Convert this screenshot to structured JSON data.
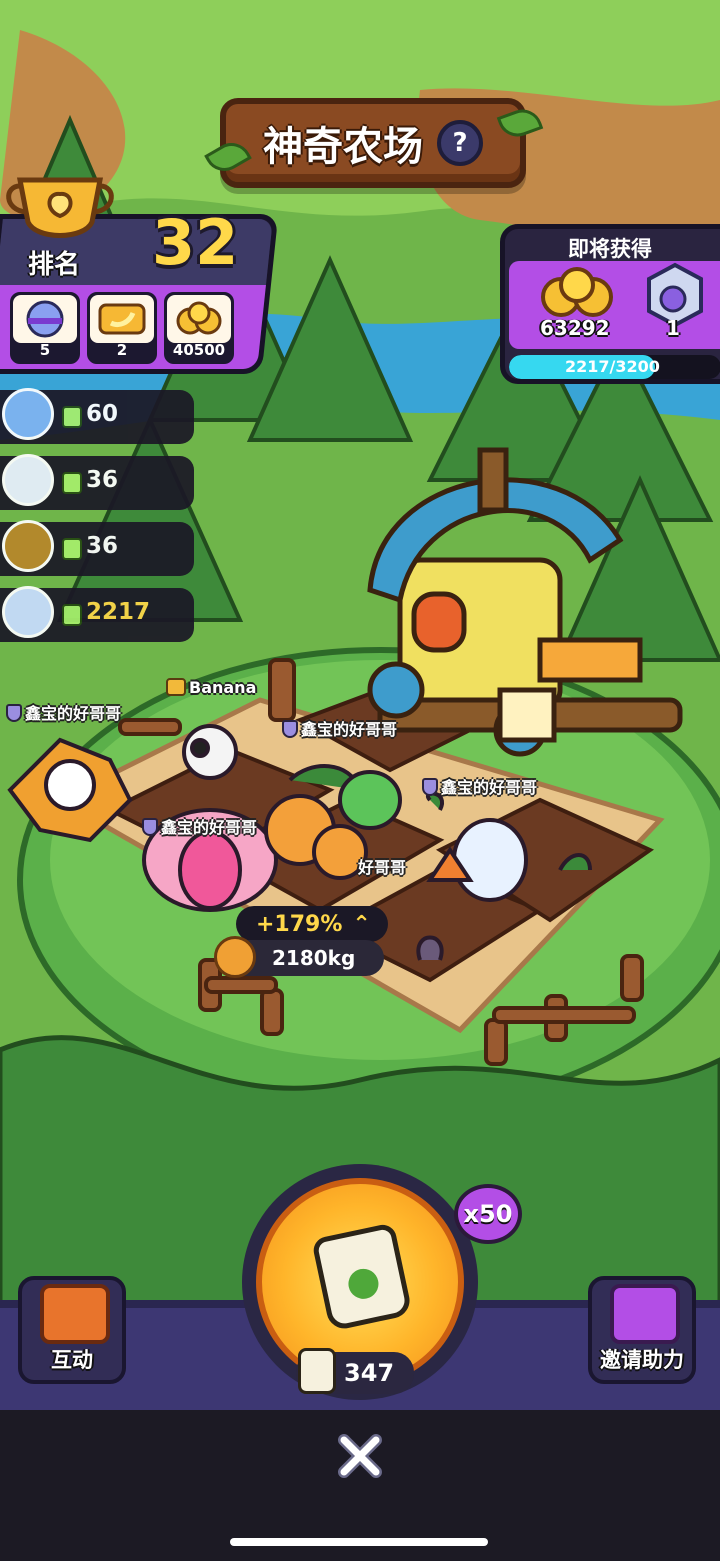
{
  "title": "神奇农场",
  "help_label": "?",
  "rank": {
    "label": "排名",
    "value": "32",
    "items": [
      {
        "icon": "pet-capsule-icon",
        "count": "5"
      },
      {
        "icon": "banana-ticket-icon",
        "count": "2"
      },
      {
        "icon": "gold-coin-icon",
        "count": "40500"
      }
    ]
  },
  "reward": {
    "title": "即将获得",
    "coins": "63292",
    "boxes": "1",
    "progress_text": "2217/3200",
    "progress": 0.69
  },
  "leaderboard": [
    {
      "value": "60",
      "gold": false
    },
    {
      "value": "36",
      "gold": false
    },
    {
      "value": "36",
      "gold": false
    },
    {
      "value": "2217",
      "gold": true
    }
  ],
  "tags": {
    "banana": "Banana",
    "player1": "鑫宝的好哥哥",
    "player2": "鑫宝的好哥哥",
    "player3": "鑫宝的好哥哥",
    "player4": "鑫宝的好哥哥",
    "player5_partial": "好哥哥"
  },
  "crop": {
    "boost": "+179%",
    "weight": "2180kg"
  },
  "bottom": {
    "interact_label": "互动",
    "invite_label": "邀请助力",
    "multiplier": "x50",
    "seed_count": "347"
  },
  "colors": {
    "accent_purple": "#b34ee6",
    "panel_dark": "#2a2440",
    "gold": "#ffd84a",
    "progress": "#36d8f0"
  }
}
